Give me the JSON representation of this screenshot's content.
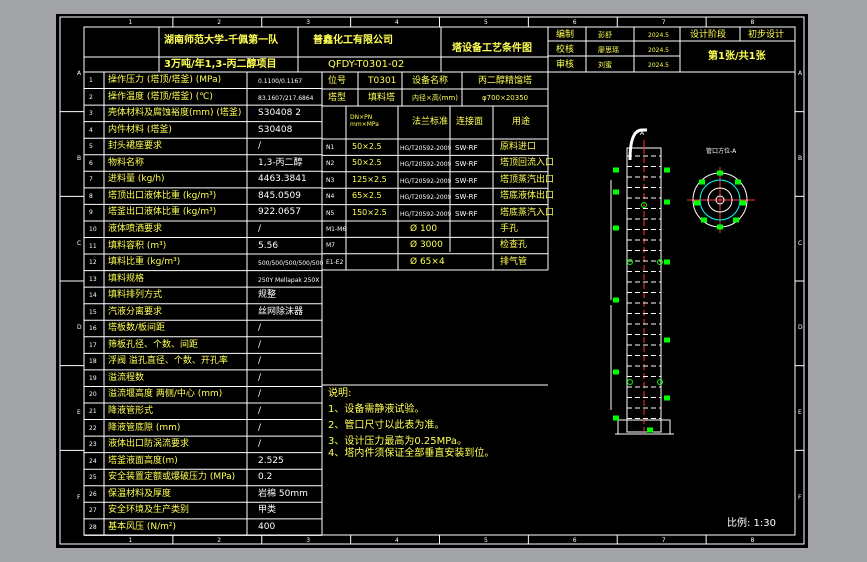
{
  "title_block": {
    "university": "湖南师范大学-千佩第一队",
    "project": "3万吨/年1,3-丙二醇项目",
    "company": "普鑫化工有限公司",
    "drawing_no": "QFDY-T0301-02",
    "drawing_title": "塔设备工艺条件图",
    "roles": [
      {
        "role": "编制",
        "name": "彭舒",
        "date": "2024.5"
      },
      {
        "role": "校核",
        "name": "廖思瑶",
        "date": "2024.5"
      },
      {
        "role": "审核",
        "name": "刘蜜",
        "date": "2024.5"
      }
    ],
    "stage_label": "设计阶段",
    "stage_value": "初步设计",
    "sheet": "第1张/共1张"
  },
  "grid": {
    "columns": [
      "1",
      "2",
      "3",
      "4",
      "5",
      "6",
      "7",
      "8"
    ],
    "rows": [
      "A",
      "B",
      "C",
      "D",
      "E",
      "F"
    ]
  },
  "header": {
    "tag_label": "位号",
    "tag_value": "T0301",
    "equip_label": "设备名称",
    "equip_value": "丙二醇精馏塔",
    "type_label": "塔型",
    "type_value": "填料塔",
    "diameter_label": "内径×高(mm)",
    "diameter_value": "φ700×20350"
  },
  "params": [
    {
      "no": "1",
      "name": "操作压力 (塔顶/塔釜)  (MPa)",
      "value": "0.1100/0.1167"
    },
    {
      "no": "2",
      "name": "操作温度 (塔顶/塔釜)  (℃)",
      "value": "83.1607/217.6864"
    },
    {
      "no": "3",
      "name": "壳体材料及腐蚀裕度(mm)  (塔釜)",
      "value": "S30408 2"
    },
    {
      "no": "4",
      "name": "内件材料 (塔釜)",
      "value": "S30408"
    },
    {
      "no": "5",
      "name": "封头裙座要求",
      "value": "/"
    },
    {
      "no": "6",
      "name": "物料名称",
      "value": "1,3-丙二醇"
    },
    {
      "no": "7",
      "name": "进料量 (kg/h)",
      "value": "4463.3841"
    },
    {
      "no": "8",
      "name": "塔顶出口液体比重 (kg/m³)",
      "value": "845.0509"
    },
    {
      "no": "9",
      "name": "塔釜出口液体比重 (kg/m³)",
      "value": "922.0657"
    },
    {
      "no": "10",
      "name": "液体喷洒要求",
      "value": "/"
    },
    {
      "no": "11",
      "name": "填料容积 (m³)",
      "value": "5.56"
    },
    {
      "no": "12",
      "name": "填料比重 (kg/m³)",
      "value": "500/500/500/500/500"
    },
    {
      "no": "13",
      "name": "填料规格",
      "value": "250Y Mellapak 250X"
    },
    {
      "no": "14",
      "name": "填料排列方式",
      "value": "规整"
    },
    {
      "no": "15",
      "name": "汽液分离要求",
      "value": "丝网除沫器"
    },
    {
      "no": "16",
      "name": "塔板数/板间距",
      "value": "/"
    },
    {
      "no": "17",
      "name": "筛板孔径、个数、间距",
      "value": "/"
    },
    {
      "no": "18",
      "name": "浮阀 溢孔直径、个数、开孔率",
      "value": "/"
    },
    {
      "no": "19",
      "name": "溢流程数",
      "value": "/"
    },
    {
      "no": "20",
      "name": "溢流堰高度 两侧/中心 (mm)",
      "value": "/"
    },
    {
      "no": "21",
      "name": "降液管形式",
      "value": "/"
    },
    {
      "no": "22",
      "name": "降液管底隙 (mm)",
      "value": "/"
    },
    {
      "no": "23",
      "name": "液体出口防涡流要求",
      "value": "/"
    },
    {
      "no": "24",
      "name": "塔釜液面高度(m)",
      "value": "2.525"
    },
    {
      "no": "25",
      "name": "安全装置定额或爆破压力 (MPa)",
      "value": "0.2"
    },
    {
      "no": "26",
      "name": "保温材料及厚度",
      "value": "岩棉 50mm"
    },
    {
      "no": "27",
      "name": "安全环境及生产类别",
      "value": "甲类"
    },
    {
      "no": "28",
      "name": "基本风压 (N/m²)",
      "value": "400"
    }
  ],
  "nozzle_headers": {
    "size": "DN×PN mm×MPa",
    "standard": "法兰标准",
    "face": "连接面",
    "purpose": "用途"
  },
  "nozzles": [
    {
      "mark": "N1",
      "size": "50×2.5",
      "standard": "HG/T20592-2009",
      "face": "SW-RF",
      "purpose": "原料进口"
    },
    {
      "mark": "N2",
      "size": "50×2.5",
      "standard": "HG/T20592-2009",
      "face": "SW-RF",
      "purpose": "塔顶回流入口"
    },
    {
      "mark": "N3",
      "size": "125×2.5",
      "standard": "HG/T20592-2009",
      "face": "SW-RF",
      "purpose": "塔顶蒸汽出口"
    },
    {
      "mark": "N4",
      "size": "65×2.5",
      "standard": "HG/T20592-2009",
      "face": "SW-RF",
      "purpose": "塔底液体出口"
    },
    {
      "mark": "N5",
      "size": "150×2.5",
      "standard": "HG/T20592-2009",
      "face": "SW-RF",
      "purpose": "塔底蒸汽入口"
    },
    {
      "mark": "M1-M6",
      "size": "",
      "standard": "Ø 100",
      "face": "",
      "purpose": "手孔"
    },
    {
      "mark": "M7",
      "size": "",
      "standard": "Ø 3000",
      "face": "",
      "purpose": "检查孔"
    },
    {
      "mark": "E1-E2",
      "size": "",
      "standard": "Ø 65×4",
      "face": "",
      "purpose": "排气管"
    }
  ],
  "notes": {
    "title": "说明:",
    "lines": [
      "1、设备需静液试验。",
      "2、管口尺寸以此表为准。",
      "3、设计压力最高为0.25MPa。",
      "4、塔内件须保证全部垂直安装到位。"
    ]
  },
  "views": {
    "side_label": "管口方位-A",
    "top_label": "A"
  },
  "scale": "比例: 1:30",
  "colors": {
    "line": "#ffffff",
    "accent": "#ffff54",
    "green": "#00ff00",
    "cyan": "#00ffff",
    "red": "#ff3030",
    "background": "#000000",
    "frame": "#a2a4a8"
  }
}
